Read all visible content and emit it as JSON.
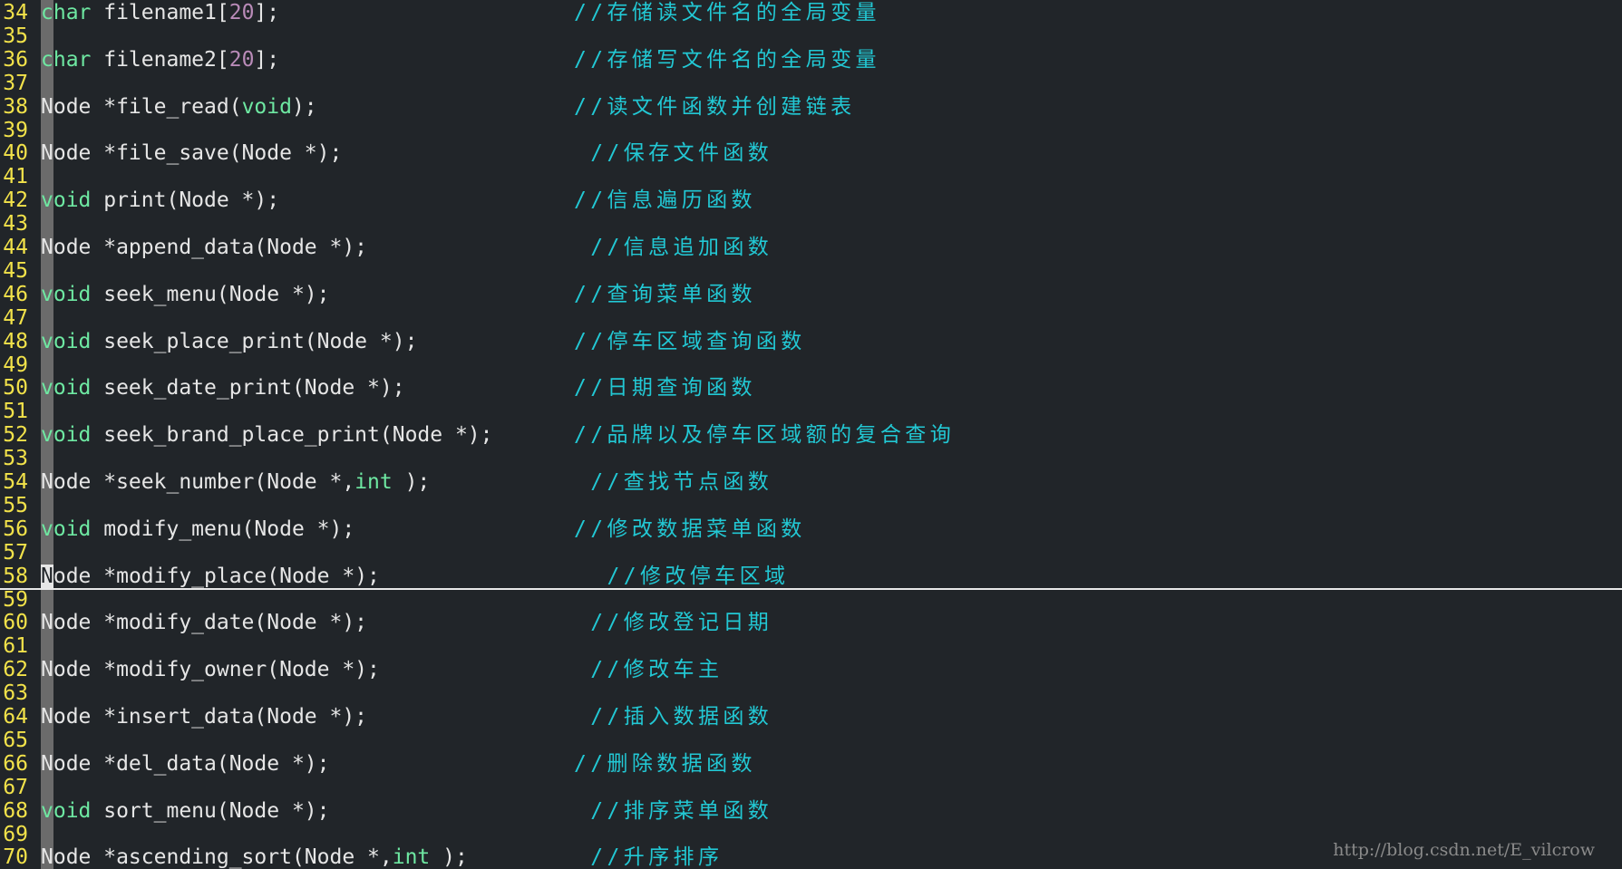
{
  "editor": {
    "cursor_line": 58,
    "lines": [
      {
        "num": "34",
        "code": [
          [
            "char",
            "kw"
          ],
          [
            " filename1[",
            ""
          ],
          [
            "20",
            "nb"
          ],
          [
            "];",
            ""
          ]
        ],
        "comment": "//存储读文件名的全局变量"
      },
      {
        "num": "35"
      },
      {
        "num": "36",
        "code": [
          [
            "char",
            "kw"
          ],
          [
            " filename2[",
            ""
          ],
          [
            "20",
            "nb"
          ],
          [
            "];",
            ""
          ]
        ],
        "comment": "//存储写文件名的全局变量"
      },
      {
        "num": "37"
      },
      {
        "num": "38",
        "code": [
          [
            "Node *file_read(",
            ""
          ],
          [
            "void",
            "kw"
          ],
          [
            ");",
            ""
          ]
        ],
        "comment": "//读文件函数并创建链表"
      },
      {
        "num": "39"
      },
      {
        "num": "40",
        "code": [
          [
            "Node *file_save(Node *);",
            ""
          ]
        ],
        "comment": " //保存文件函数"
      },
      {
        "num": "41"
      },
      {
        "num": "42",
        "code": [
          [
            "void",
            "kw"
          ],
          [
            " print(Node *);",
            ""
          ]
        ],
        "comment": "//信息遍历函数"
      },
      {
        "num": "43"
      },
      {
        "num": "44",
        "code": [
          [
            "Node *append_data(Node *);",
            ""
          ]
        ],
        "comment": " //信息追加函数"
      },
      {
        "num": "45"
      },
      {
        "num": "46",
        "code": [
          [
            "void",
            "kw"
          ],
          [
            " seek_menu(Node *);",
            ""
          ]
        ],
        "comment": "//查询菜单函数"
      },
      {
        "num": "47"
      },
      {
        "num": "48",
        "code": [
          [
            "void",
            "kw"
          ],
          [
            " seek_place_print(Node *);",
            ""
          ]
        ],
        "comment": "//停车区域查询函数"
      },
      {
        "num": "49"
      },
      {
        "num": "50",
        "code": [
          [
            "void",
            "kw"
          ],
          [
            " seek_date_print(Node *);",
            ""
          ]
        ],
        "comment": "//日期查询函数"
      },
      {
        "num": "51"
      },
      {
        "num": "52",
        "code": [
          [
            "void",
            "kw"
          ],
          [
            " seek_brand_place_print(Node *);",
            ""
          ]
        ],
        "comment": "//品牌以及停车区域额的复合查询"
      },
      {
        "num": "53"
      },
      {
        "num": "54",
        "code": [
          [
            "Node *seek_number(Node *,",
            ""
          ],
          [
            "int",
            "kw"
          ],
          [
            " );",
            ""
          ]
        ],
        "comment": " //查找节点函数"
      },
      {
        "num": "55"
      },
      {
        "num": "56",
        "code": [
          [
            "void",
            "kw"
          ],
          [
            " modify_menu(Node *);",
            ""
          ]
        ],
        "comment": "//修改数据菜单函数"
      },
      {
        "num": "57"
      },
      {
        "num": "58",
        "code": [
          [
            "N",
            "cursor"
          ],
          [
            "ode *modify_place(Node *);",
            ""
          ]
        ],
        "comment": "  //修改停车区域"
      },
      {
        "num": "59"
      },
      {
        "num": "60",
        "code": [
          [
            "Node *modify_date(Node *);",
            ""
          ]
        ],
        "comment": " //修改登记日期"
      },
      {
        "num": "61"
      },
      {
        "num": "62",
        "code": [
          [
            "Node *modify_owner(Node *);",
            ""
          ]
        ],
        "comment": " //修改车主"
      },
      {
        "num": "63"
      },
      {
        "num": "64",
        "code": [
          [
            "Node *insert_data(Node *);",
            ""
          ]
        ],
        "comment": " //插入数据函数"
      },
      {
        "num": "65"
      },
      {
        "num": "66",
        "code": [
          [
            "Node *del_data(Node *);",
            ""
          ]
        ],
        "comment": "//删除数据函数"
      },
      {
        "num": "67"
      },
      {
        "num": "68",
        "code": [
          [
            "void",
            "kw"
          ],
          [
            " sort_menu(Node *);",
            ""
          ]
        ],
        "comment": " //排序菜单函数"
      },
      {
        "num": "69"
      },
      {
        "num": "70",
        "code": [
          [
            "Node *ascending_sort(Node *,",
            ""
          ],
          [
            "int",
            "kw"
          ],
          [
            " );",
            ""
          ]
        ],
        "comment": " //升序排序"
      }
    ]
  },
  "watermark": "http://blog.csdn.net/E_vilcrow"
}
